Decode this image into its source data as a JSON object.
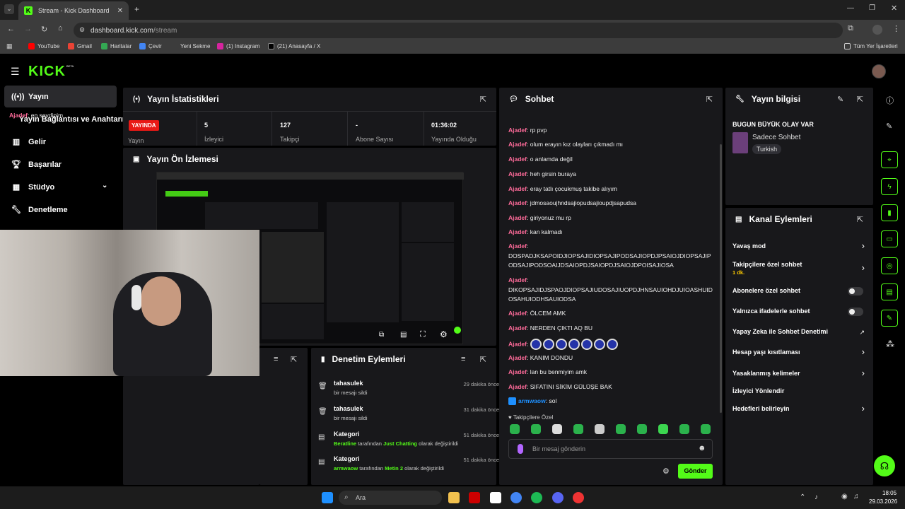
{
  "browser": {
    "tab_title": "Stream - Kick Dashboard",
    "tab_favicon": "K",
    "url_host": "dashboard.kick.com",
    "url_path": "/stream",
    "bookmarks": [
      "YouTube",
      "Gmail",
      "Haritalar",
      "Çevir",
      "Yeni Sekme",
      "(1) Instagram",
      "(21) Anasayfa / X"
    ],
    "all_bookmarks": "Tüm Yer İşaretleri"
  },
  "app": {
    "logo": "KICK",
    "logo_badge": "BETA"
  },
  "sidebar": {
    "items": [
      {
        "label": "Yayın",
        "icon": "broadcast-icon"
      },
      {
        "label": "Yayın Bağlantısı ve Anahtarı",
        "icon": ""
      },
      {
        "label": "Gelir",
        "icon": "chart-icon"
      },
      {
        "label": "Başarılar",
        "icon": "trophy-icon"
      },
      {
        "label": "Stüdyo",
        "icon": "grid-icon"
      },
      {
        "label": "Denetleme",
        "icon": "wrench-icon"
      }
    ]
  },
  "stats": {
    "title": "Yayın İstatistikleri",
    "live_badge": "YAYINDA",
    "live_label": "Yayın",
    "items": [
      {
        "value": "5",
        "label": "İzleyici"
      },
      {
        "value": "127",
        "label": "Takipçi"
      },
      {
        "value": "-",
        "label": "Abone Sayısı"
      },
      {
        "value": "01:36:02",
        "label": "Yayında Olduğu"
      }
    ]
  },
  "preview": {
    "title": "Yayın Ön İzlemesi"
  },
  "moderation": {
    "title": "Denetim Eylemleri",
    "items": [
      {
        "name": "tahasulek",
        "desc": "bir mesajı sildi",
        "time": "29 dakika önce",
        "type": "trash"
      },
      {
        "name": "tahasulek",
        "desc": "bir mesajı sildi",
        "time": "31 dakika önce",
        "type": "trash"
      },
      {
        "name": "Kategori",
        "desc_user": "Beratline",
        "desc_mid": "tarafından",
        "desc_cat": "Just Chatting",
        "desc_end": "olarak değiştirildi",
        "time": "51 dakika önce",
        "type": "category"
      },
      {
        "name": "Kategori",
        "desc_user": "armwaow",
        "desc_mid": "tarafından",
        "desc_cat": "Metin 2",
        "desc_end": "olarak değiştirildi",
        "time": "51 dakika önce",
        "type": "category"
      }
    ]
  },
  "chat": {
    "title": "Sohbet",
    "messages": [
      {
        "user": "Ajadef",
        "text": "en sevdipim"
      },
      {
        "user": "Ajadef",
        "text": "rp pvp"
      },
      {
        "user": "Ajadef",
        "text": "olum erayın kız olayları çıkmadı mı"
      },
      {
        "user": "Ajadef",
        "text": "o anlamda değil"
      },
      {
        "user": "Ajadef",
        "text": "heh girsin buraya"
      },
      {
        "user": "Ajadef",
        "text": "eray tatlı çocukmuş takibe alıyım"
      },
      {
        "user": "Ajadef",
        "text": "jdmosaoujhndsajiopudsajioupdjsapudsa"
      },
      {
        "user": "Ajadef",
        "text": "giriyonuz mu rp"
      },
      {
        "user": "Ajadef",
        "text": "kan kalmadı"
      },
      {
        "user": "Ajadef",
        "text": "DOSPADJKSAPOIDJIOPSAJIDIOPSAJIPODSAJIOPDJPSAIOJDIOPSAJIPODSAJIPODSOAIJDSAIOPDJSAIOPDJSAIOJDPOISAJIOSA"
      },
      {
        "user": "Ajadef",
        "text": "DIKOPSAJIDJSPAOJDIOPSAJIUDOSAJIUOPDJHNSAUIOHDJUIOASHUIDOSAHUIODHSAUIODSA"
      },
      {
        "user": "Ajadef",
        "text": "ÖLCEM AMK"
      },
      {
        "user": "Ajadef",
        "text": "NERDEN ÇIKTI AQ BU"
      },
      {
        "user": "Ajadef",
        "text": ""
      },
      {
        "user": "Ajadef",
        "text": "KANIM DONDU"
      },
      {
        "user": "Ajadef",
        "text": "lan bu benmiyim amk"
      },
      {
        "user": "Ajadef",
        "text": "SIFATINI SİKİM GÜLÜŞE BAK"
      },
      {
        "user": "armwaow",
        "text": "sol"
      }
    ],
    "followers_only_label": "Takipçilere Özel",
    "input_placeholder": "Bir mesaj gönderin",
    "send_label": "Gönder"
  },
  "stream_info": {
    "title": "Yayın bilgisi",
    "stream_title": "BUGUN BÜYÜK OLAY VAR",
    "category": "Sadece Sohbet",
    "language_tag": "Turkish"
  },
  "channel_actions": {
    "title": "Kanal Eylemleri",
    "items": [
      {
        "label": "Yavaş mod",
        "control": "chevron"
      },
      {
        "label": "Takipçilere özel sohbet",
        "sub": "1 dk.",
        "control": "chevron"
      },
      {
        "label": "Abonelere özel sohbet",
        "control": "toggle"
      },
      {
        "label": "Yalnızca ifadelerle sohbet",
        "control": "toggle"
      },
      {
        "label": "Yapay Zeka ile Sohbet Denetimi",
        "control": "external"
      },
      {
        "label": "Hesap yaşı kısıtlaması",
        "control": "chevron"
      },
      {
        "label": "Yasaklanmış kelimeler",
        "control": "chevron"
      },
      {
        "label": "İzleyici Yönlendir",
        "control": "none"
      },
      {
        "label": "Hedefleri belirleyin",
        "control": "chevron"
      }
    ]
  },
  "taskbar": {
    "search_placeholder": "Ara",
    "time": "18:05",
    "date": "29.03.2026"
  },
  "colors": {
    "accent": "#53fc18",
    "username": "#ff6b9a",
    "panel": "#18181b",
    "live": "#e91916"
  }
}
